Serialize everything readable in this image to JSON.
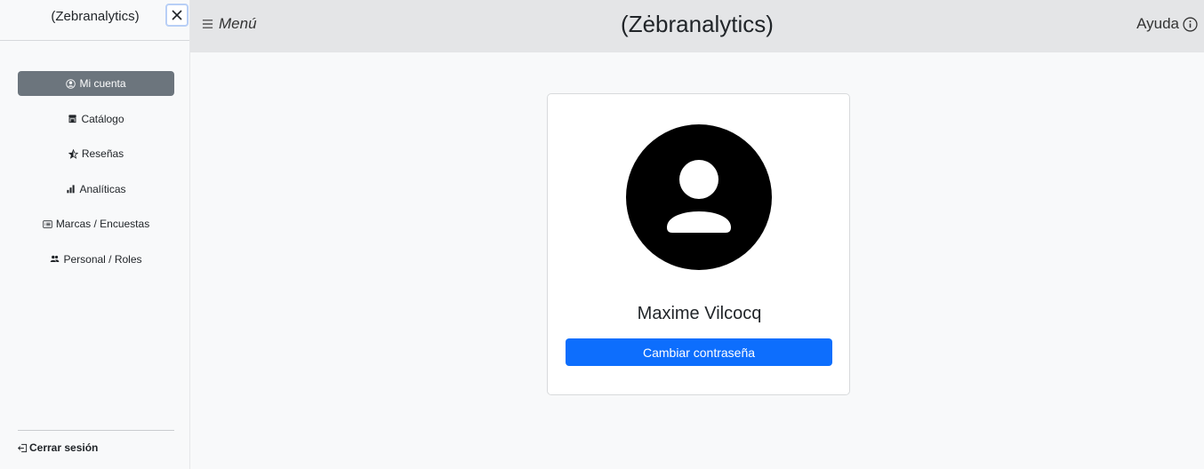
{
  "sidebar": {
    "title": "(Zebranalytics)",
    "items": [
      {
        "label": "Mi cuenta",
        "icon": "person-circle-icon",
        "active": true
      },
      {
        "label": "Catálogo",
        "icon": "shop-icon",
        "active": false
      },
      {
        "label": "Reseñas",
        "icon": "star-half-icon",
        "active": false
      },
      {
        "label": "Analíticas",
        "icon": "bar-chart-icon",
        "active": false
      },
      {
        "label": "Marcas / Encuestas",
        "icon": "card-list-icon",
        "active": false
      },
      {
        "label": "Personal / Roles",
        "icon": "people-icon",
        "active": false
      }
    ],
    "logout_label": "Cerrar sesión"
  },
  "topbar": {
    "menu_label": "Menú",
    "title": "(Zėbranalytics)",
    "help_label": "Ayuda"
  },
  "profile": {
    "name": "Maxime Vilcocq",
    "change_password_label": "Cambiar contraseña"
  },
  "colors": {
    "primary": "#0d6efd",
    "active_nav": "#6c757d",
    "topbar_bg": "#e4e5e7",
    "page_bg": "#f8f9fa"
  }
}
